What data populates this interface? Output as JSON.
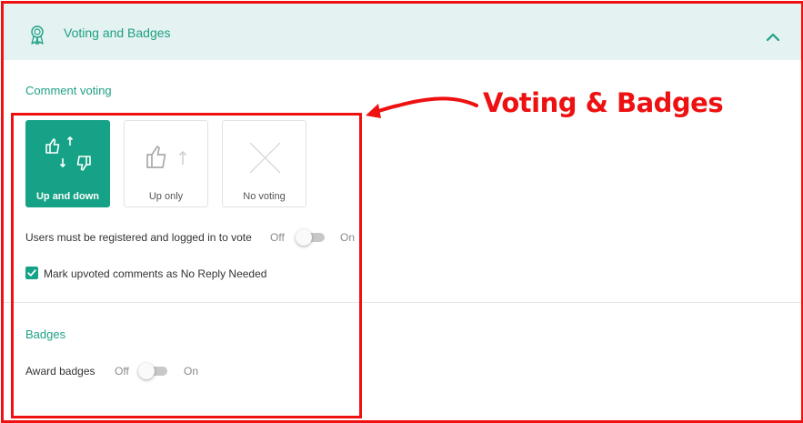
{
  "header": {
    "title": "Voting and Badges",
    "icon": "award-ribbon-icon",
    "collapse_icon": "chevron-up-icon"
  },
  "comment_voting": {
    "title": "Comment voting",
    "options": [
      {
        "label": "Up and down",
        "icon": "thumbs-up-down-icon",
        "selected": true
      },
      {
        "label": "Up only",
        "icon": "thumbs-up-icon",
        "selected": false
      },
      {
        "label": "No voting",
        "icon": "x-icon",
        "selected": false
      }
    ],
    "registered_setting": {
      "label": "Users must be registered and logged in to vote",
      "off_label": "Off",
      "on_label": "On",
      "value": "Off"
    },
    "no_reply_checkbox": {
      "label": "Mark upvoted comments as No Reply Needed",
      "checked": true
    }
  },
  "badges": {
    "title": "Badges",
    "award_setting": {
      "label": "Award badges",
      "off_label": "Off",
      "on_label": "On",
      "value": "Off"
    }
  },
  "annotation": {
    "text": "Voting & Badges",
    "color": "#ee1111"
  },
  "colors": {
    "accent": "#16a286",
    "header_bg": "#e4f2f1",
    "annotation_red": "#ee1111"
  }
}
